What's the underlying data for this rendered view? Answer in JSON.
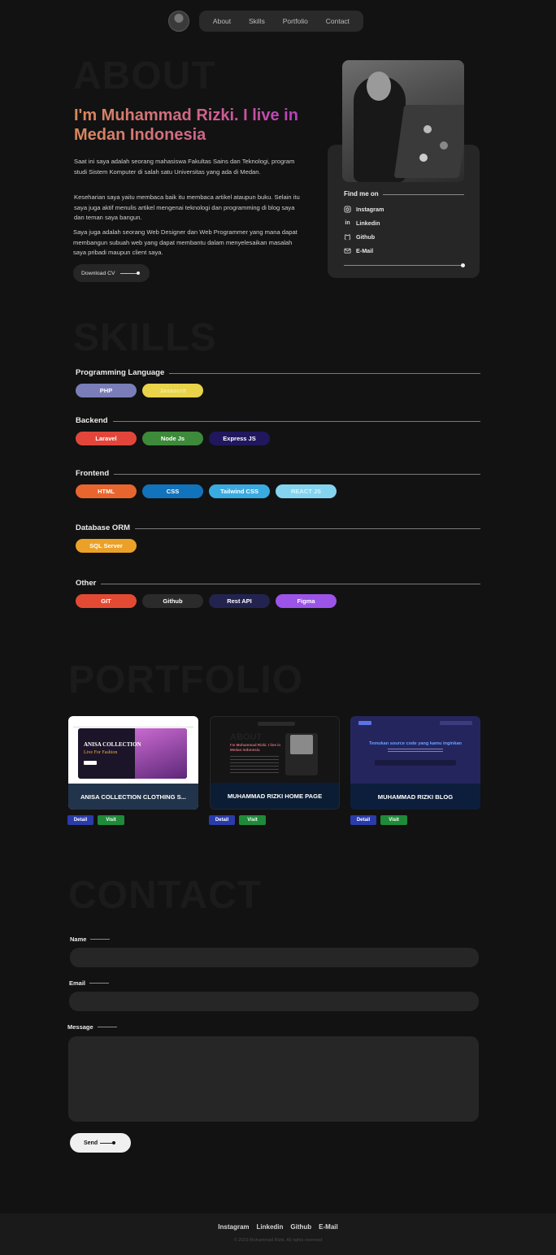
{
  "nav": {
    "avatar_icon": "profile-avatar",
    "items": [
      "About",
      "Skills",
      "Portfolio",
      "Contact"
    ]
  },
  "about": {
    "ghost_title": "ABOUT",
    "headline": "I'm Muhammad Rizki. I live in Medan Indonesia",
    "paragraphs": [
      "Saat ini saya adalah seorang mahasiswa Fakultas Sains dan Teknologi, program studi Sistem Komputer di salah satu Universitas yang ada di Medan.",
      "Keseharian saya yaitu membaca baik itu membaca artikel ataupun buku. Selain itu saya juga aktif menulis artikel mengenai teknologi dan programming di blog saya dan teman saya bangun.",
      "Saya juga adalah seorang Web Designer dan Web Programmer yang mana dapat membangun subuah web yang dapat membantu dalam menyelesaikan masalah saya pribadi maupun client saya."
    ],
    "download_cv": "Download CV",
    "find_me_on": "Find me on",
    "socials": [
      {
        "label": "Instagram",
        "icon": "instagram-icon"
      },
      {
        "label": "Linkedin",
        "icon": "linkedin-icon"
      },
      {
        "label": "Github",
        "icon": "github-icon"
      },
      {
        "label": "E-Mail",
        "icon": "mail-icon"
      }
    ]
  },
  "skills": {
    "ghost_title": "SKILLS",
    "categories": [
      {
        "name": "Programming Language",
        "items": [
          {
            "label": "PHP",
            "color": "#7a7eb8",
            "text": "#ffffff"
          },
          {
            "label": "Javascrit",
            "color": "#e8d34a",
            "text": "#f2ec9e"
          }
        ]
      },
      {
        "name": "Backend",
        "items": [
          {
            "label": "Laravel",
            "color": "#e2463b",
            "text": "#ffffff"
          },
          {
            "label": "Node Js",
            "color": "#3d8a3a",
            "text": "#ffffff"
          },
          {
            "label": "Express JS",
            "color": "#21175e",
            "text": "#ffffff"
          }
        ]
      },
      {
        "name": "Frontend",
        "items": [
          {
            "label": "HTML",
            "color": "#e8652e",
            "text": "#ffffff"
          },
          {
            "label": "CSS",
            "color": "#1273bd",
            "text": "#ffffff"
          },
          {
            "label": "Tailwind CSS",
            "color": "#3aabe0",
            "text": "#ffffff"
          },
          {
            "label": "REACT JS",
            "color": "#84d4f0",
            "text": "#d9f4ff"
          }
        ]
      },
      {
        "name": "Database ORM",
        "items": [
          {
            "label": "SQL Server",
            "color": "#eba127",
            "text": "#ffffff"
          }
        ]
      },
      {
        "name": "Other",
        "items": [
          {
            "label": "GIT",
            "color": "#e34a34",
            "text": "#ffffff"
          },
          {
            "label": "Github",
            "color": "#2b2b2b",
            "text": "#ffffff"
          },
          {
            "label": "Rest API",
            "color": "#23234f",
            "text": "#ffffff"
          },
          {
            "label": "Figma",
            "color": "#9b53e8",
            "text": "#ffffff"
          }
        ]
      }
    ]
  },
  "portfolio": {
    "ghost_title": "PORTFOLIO",
    "projects": [
      {
        "title": "ANISA COLLECTION CLOTHING S...",
        "thumb_heading": "ANISA COLLECTION",
        "thumb_sub": "Live For Fashion",
        "detail": "Detail",
        "visit": "Visit"
      },
      {
        "title": "MUHAMMAD RIZKI HOME PAGE",
        "thumb_heading": "ABOUT",
        "thumb_sub": "I'm Muhammad Rizki. I live in Medan Indonesia",
        "detail": "Detail",
        "visit": "Visit"
      },
      {
        "title": "MUHAMMAD RIZKI BLOG",
        "thumb_heading": "Temukan source code yang kamu inginkan",
        "thumb_sub": "",
        "detail": "Detail",
        "visit": "Visit"
      }
    ]
  },
  "contact": {
    "ghost_title": "CONTACT",
    "name_label": "Name",
    "email_label": "Email",
    "message_label": "Message",
    "send": "Send"
  },
  "footer": {
    "links": [
      "Instagram",
      "Linkedin",
      "Github",
      "E-Mail"
    ],
    "copyright": "© 2023 Muhammad Rizki. All rights reserved"
  }
}
